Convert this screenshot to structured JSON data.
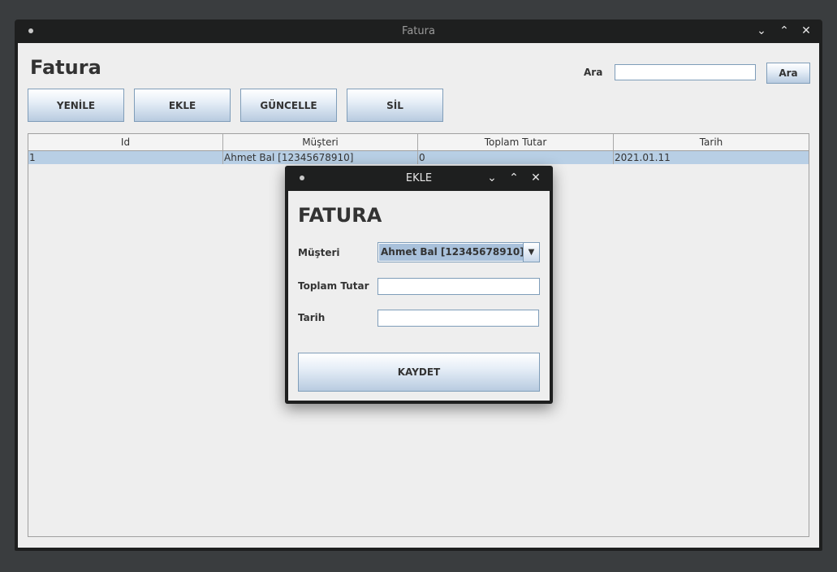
{
  "window": {
    "title": "Fatura",
    "controls": {
      "minimize_icon": "⌄",
      "maximize_icon": "⌃",
      "close_icon": "✕"
    }
  },
  "app": {
    "heading": "Fatura"
  },
  "search": {
    "label": "Ara",
    "value": "",
    "button_label": "Ara"
  },
  "toolbar": {
    "refresh_label": "YENİLE",
    "add_label": "EKLE",
    "update_label": "GÜNCELLE",
    "delete_label": "SİL"
  },
  "table": {
    "columns": [
      "Id",
      "Müşteri",
      "Toplam Tutar",
      "Tarih"
    ],
    "rows": [
      {
        "id": "1",
        "customer": "Ahmet Bal [12345678910]",
        "total": "0",
        "date": "2021.01.11"
      }
    ]
  },
  "dialog": {
    "title": "EKLE",
    "heading": "FATURA",
    "customer_label": "Müşteri",
    "customer_selected": "Ahmet Bal [12345678910]",
    "total_label": "Toplam Tutar",
    "total_value": "",
    "date_label": "Tarih",
    "date_value": "",
    "save_label": "KAYDET"
  },
  "colors": {
    "accent": "#b8cfe5",
    "selection": "#a9c1db",
    "titlebar": "#1e1f1f"
  }
}
